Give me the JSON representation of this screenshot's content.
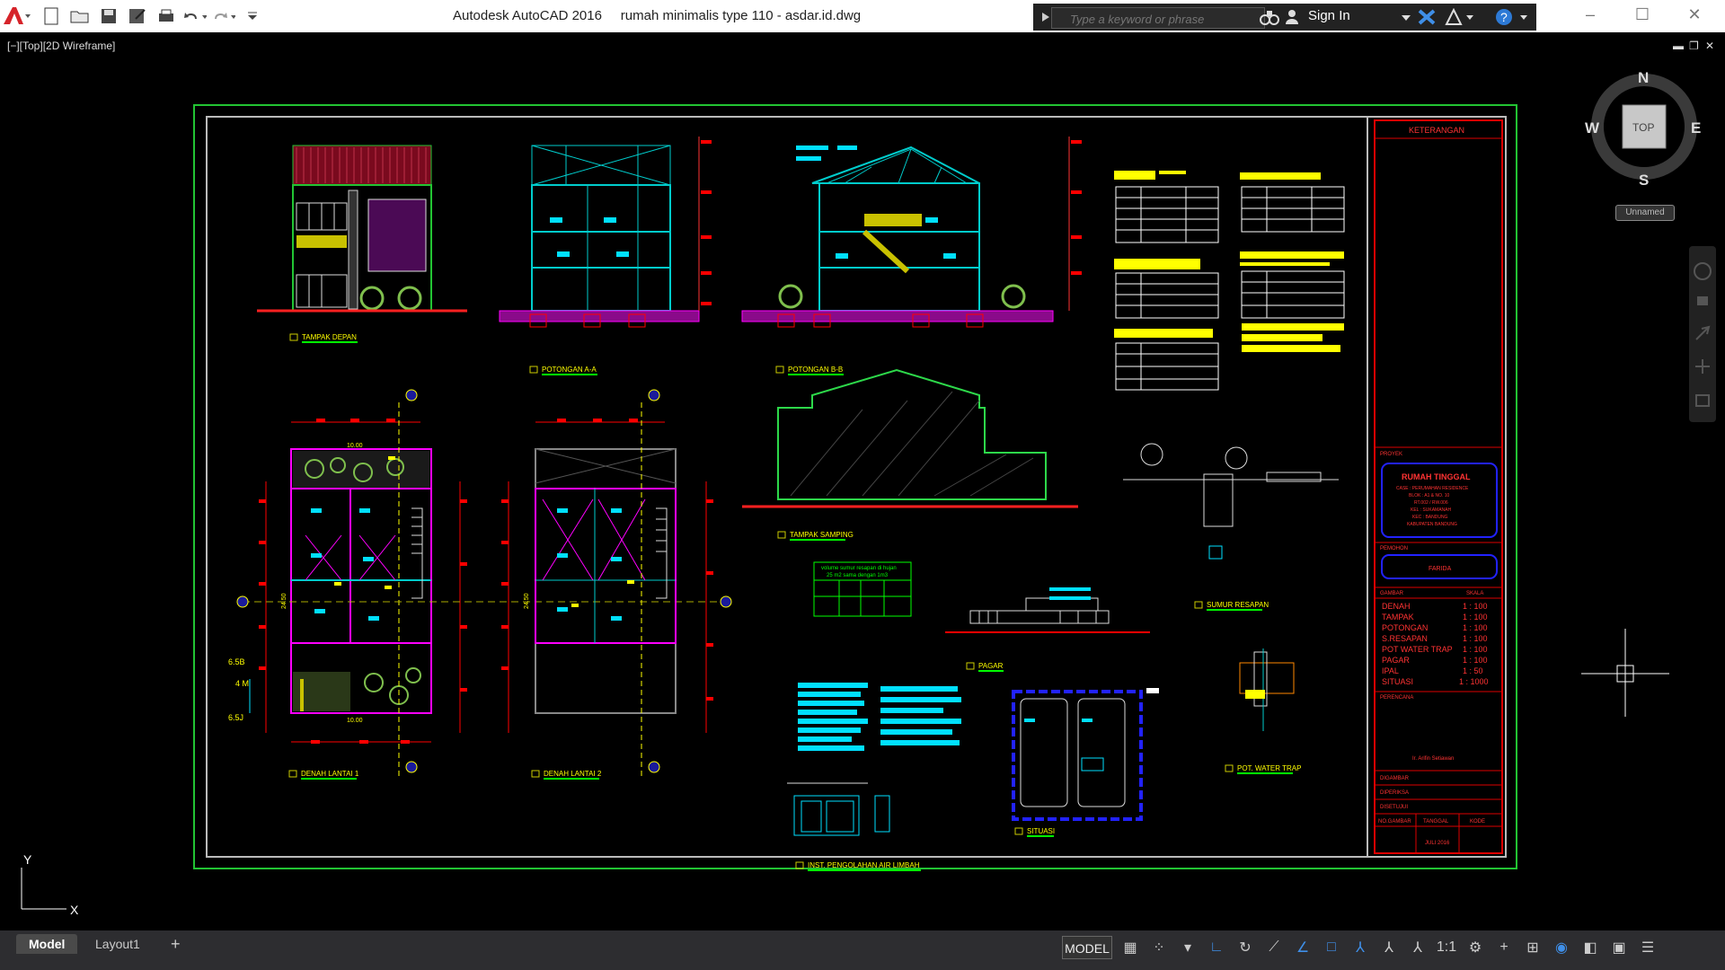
{
  "window": {
    "app_title": "Autodesk AutoCAD 2016",
    "doc_title": "rumah minimalis type 110 - asdar.id.dwg",
    "search_placeholder": "Type a keyword or phrase",
    "sign_in": "Sign In",
    "controls": [
      "minimize",
      "maximize",
      "close"
    ]
  },
  "viewport": {
    "label": "[−][Top][2D Wireframe]",
    "viewcube": {
      "N": "N",
      "S": "S",
      "E": "E",
      "W": "W",
      "top": "TOP"
    },
    "ucs_label": "Unnamed",
    "axis_y": "Y",
    "axis_x": "X"
  },
  "drawing_labels": {
    "tampak_depan": "TAMPAK DEPAN",
    "potongan_aa": "POTONGAN A-A",
    "potongan_bb": "POTONGAN B-B",
    "tampak_samping": "TAMPAK SAMPING",
    "denah_lantai_1": "DENAH LANTAI 1",
    "denah_lantai_2": "DENAH LANTAI 2",
    "pagar": "PAGAR",
    "sumur_resapan": "SUMUR RESAPAN",
    "pot_water_trap": "POT. WATER TRAP",
    "inst_limbah": "INST. PENGOLAHAN AIR LIMBAH",
    "situasi": "SITUASI",
    "sumur_note": [
      "volume sumur resapan di hujan",
      "25 m2 sama dengan 1m3"
    ],
    "dim_top": "10.00",
    "dim_bottom": "10.00",
    "dim_side_1": "24.50",
    "dim_side_2": "24.50",
    "left_marks": [
      "6.5B",
      "4 M",
      "6.5J"
    ]
  },
  "title_block": {
    "keterangan": "KETERANGAN",
    "proyek": "PROYEK",
    "project_title": "RUMAH TINGGAL",
    "project_lines": [
      "CASE : PERUMAHAN RESIDENCE",
      "BLOK : A1 & NO. 10",
      "RT.002 / RW.006",
      "KEL : SUKAMANAH",
      "KEC : BANDUNG",
      "KABUPATEN BANDUNG"
    ],
    "pemohon": "PEMOHON",
    "pemohon_name": "FARIDA",
    "gambar": "GAMBAR",
    "skala": "SKALA",
    "sheets": [
      {
        "name": "DENAH",
        "scale": "1 : 100"
      },
      {
        "name": "TAMPAK",
        "scale": "1 : 100"
      },
      {
        "name": "POTONGAN",
        "scale": "1 : 100"
      },
      {
        "name": "S.RESAPAN",
        "scale": "1 : 100"
      },
      {
        "name": "POT WATER TRAP",
        "scale": "1 : 100"
      },
      {
        "name": "PAGAR",
        "scale": "1 : 100"
      },
      {
        "name": "IPAL",
        "scale": "1 : 50"
      },
      {
        "name": "SITUASI",
        "scale": "1 : 1000"
      }
    ],
    "perencana": "PERENCANA",
    "perencana_name": "Ir. Arifin Setiawan",
    "digambar": "DIGAMBAR",
    "diperiksa": "DIPERIKSA",
    "disetujui": "DISETUJUI",
    "no_gambar": "NO.GAMBAR",
    "tanggal": "TANGGAL",
    "kode": "KODE",
    "date": "JULI 2016"
  },
  "status": {
    "tabs": [
      "Model",
      "Layout1"
    ],
    "add_tab": "+",
    "model_btn": "MODEL",
    "scale": "1:1"
  }
}
